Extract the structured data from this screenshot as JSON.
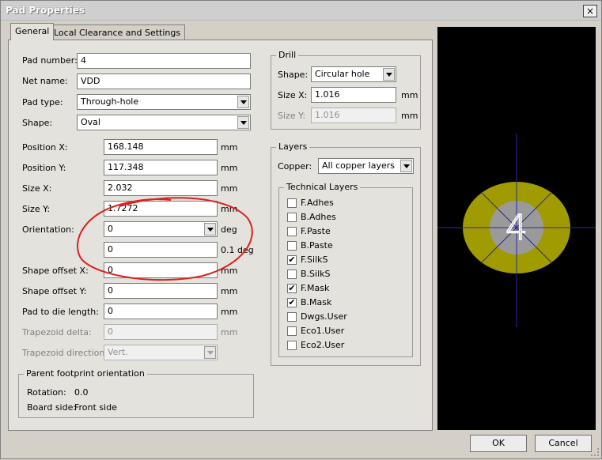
{
  "window": {
    "title": "Pad Properties",
    "close_glyph": "×"
  },
  "tabs": [
    "General",
    "Local Clearance and Settings"
  ],
  "general": {
    "pad_number": {
      "label": "Pad number:",
      "value": "4"
    },
    "net_name": {
      "label": "Net name:",
      "value": "VDD"
    },
    "pad_type": {
      "label": "Pad type:",
      "value": "Through-hole"
    },
    "shape": {
      "label": "Shape:",
      "value": "Oval"
    },
    "position_x": {
      "label": "Position X:",
      "value": "168.148",
      "unit": "mm"
    },
    "position_y": {
      "label": "Position Y:",
      "value": "117.348",
      "unit": "mm"
    },
    "size_x": {
      "label": "Size X:",
      "value": "2.032",
      "unit": "mm"
    },
    "size_y": {
      "label": "Size Y:",
      "value": "1.7272",
      "unit": "mm"
    },
    "orientation": {
      "label": "Orientation:",
      "value": "0",
      "unit": "deg",
      "value2": "0",
      "unit2": "0.1 deg"
    },
    "shape_offset_x": {
      "label": "Shape offset X:",
      "value": "0",
      "unit": "mm"
    },
    "shape_offset_y": {
      "label": "Shape offset Y:",
      "value": "0",
      "unit": "mm"
    },
    "pad_to_die": {
      "label": "Pad to die length:",
      "value": "0",
      "unit": "mm"
    },
    "trapezoid_delta": {
      "label": "Trapezoid delta:",
      "value": "0",
      "unit": "mm"
    },
    "trapezoid_direction": {
      "label": "Trapezoid direction:",
      "value": "Vert."
    }
  },
  "parent_orientation": {
    "title": "Parent footprint orientation",
    "rotation_label": "Rotation:",
    "rotation_value": "0.0",
    "board_side_label": "Board side:",
    "board_side_value": "Front side"
  },
  "drill": {
    "title": "Drill",
    "shape_label": "Shape:",
    "shape_value": "Circular hole",
    "size_x_label": "Size X:",
    "size_x_value": "1.016",
    "size_x_unit": "mm",
    "size_y_label": "Size Y:",
    "size_y_value": "1.016",
    "size_y_unit": "mm"
  },
  "layers": {
    "title": "Layers",
    "copper_label": "Copper:",
    "copper_value": "All copper layers",
    "technical_title": "Technical Layers",
    "technical": [
      {
        "name": "F.Adhes",
        "checked": false
      },
      {
        "name": "B.Adhes",
        "checked": false
      },
      {
        "name": "F.Paste",
        "checked": false
      },
      {
        "name": "B.Paste",
        "checked": false
      },
      {
        "name": "F.SilkS",
        "checked": true
      },
      {
        "name": "B.SilkS",
        "checked": false
      },
      {
        "name": "F.Mask",
        "checked": true
      },
      {
        "name": "B.Mask",
        "checked": true
      },
      {
        "name": "Dwgs.User",
        "checked": false
      },
      {
        "name": "Eco1.User",
        "checked": false
      },
      {
        "name": "Eco2.User",
        "checked": false
      }
    ]
  },
  "preview": {
    "pad_label": "4",
    "colors": {
      "background": "#000000",
      "copper": "#a09b00",
      "hole": "#9a9a9a",
      "crosshair": "#2a2aa0",
      "label": "#ffffff"
    }
  },
  "buttons": {
    "ok": "OK",
    "cancel": "Cancel"
  },
  "annotation": {
    "color": "#e02020"
  },
  "check_glyph": "✔"
}
